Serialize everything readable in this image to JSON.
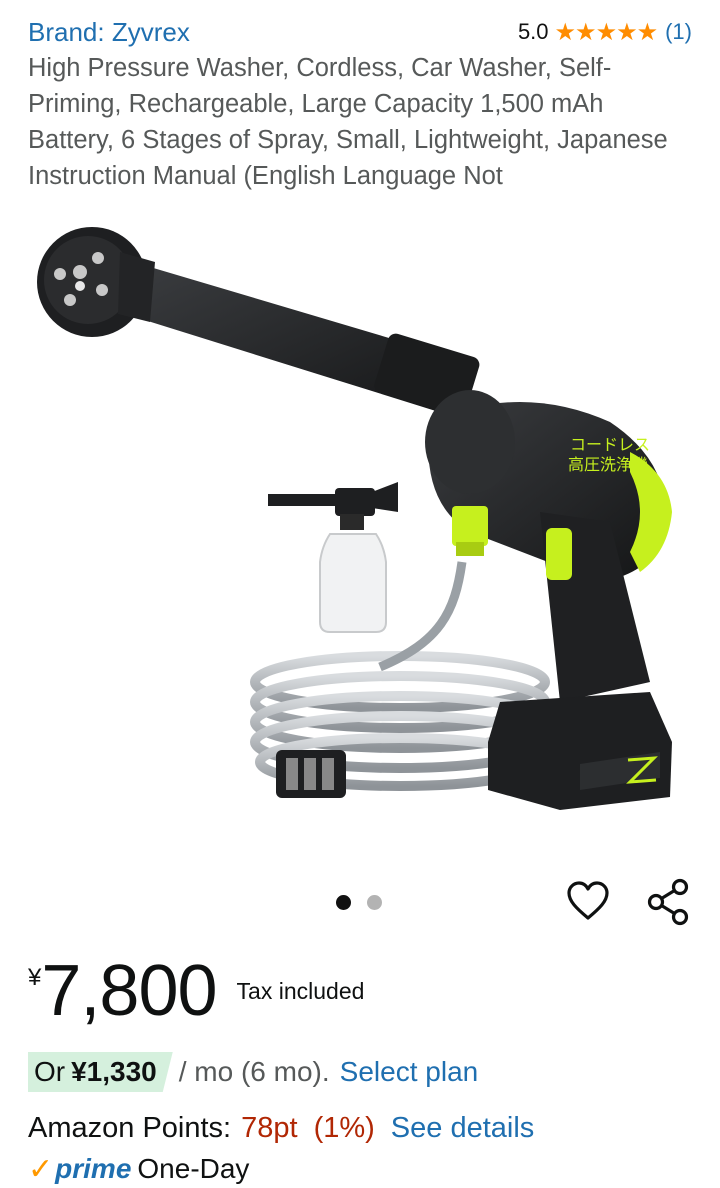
{
  "header": {
    "brand_label": "Brand: Zyvrex",
    "rating_value": "5.0",
    "rating_stars": "★★★★★",
    "rating_count": "(1)",
    "title": "High Pressure Washer, Cordless, Car Washer, Self-Priming, Rechargeable, Large Capacity 1,500 mAh Battery, 6 Stages of Spray, Small, Lightweight, Japanese Instruction Manual (English Language Not"
  },
  "gallery": {
    "image_count": 2,
    "active_index": 0,
    "product_text_jp_1": "コードレス",
    "product_text_jp_2": "高圧洗浄機",
    "colors": {
      "accent_green": "#c6f01e",
      "body_black": "#1e1f21"
    }
  },
  "actions": {
    "wishlist_icon": "heart-outline",
    "share_icon": "share-nodes"
  },
  "price": {
    "currency": "¥",
    "amount": "7,800",
    "tax_note": "Tax included"
  },
  "installment": {
    "or_label": "Or",
    "monthly_amount": "¥1,330",
    "per_month_text": "/ mo (6 mo).",
    "select_plan_label": "Select plan"
  },
  "points": {
    "label": "Amazon Points:",
    "value": "78pt",
    "percent": "(1%)",
    "details_link": "See details"
  },
  "delivery": {
    "prime_check": "✓",
    "prime_label": "prime",
    "speed_label": "One-Day"
  }
}
